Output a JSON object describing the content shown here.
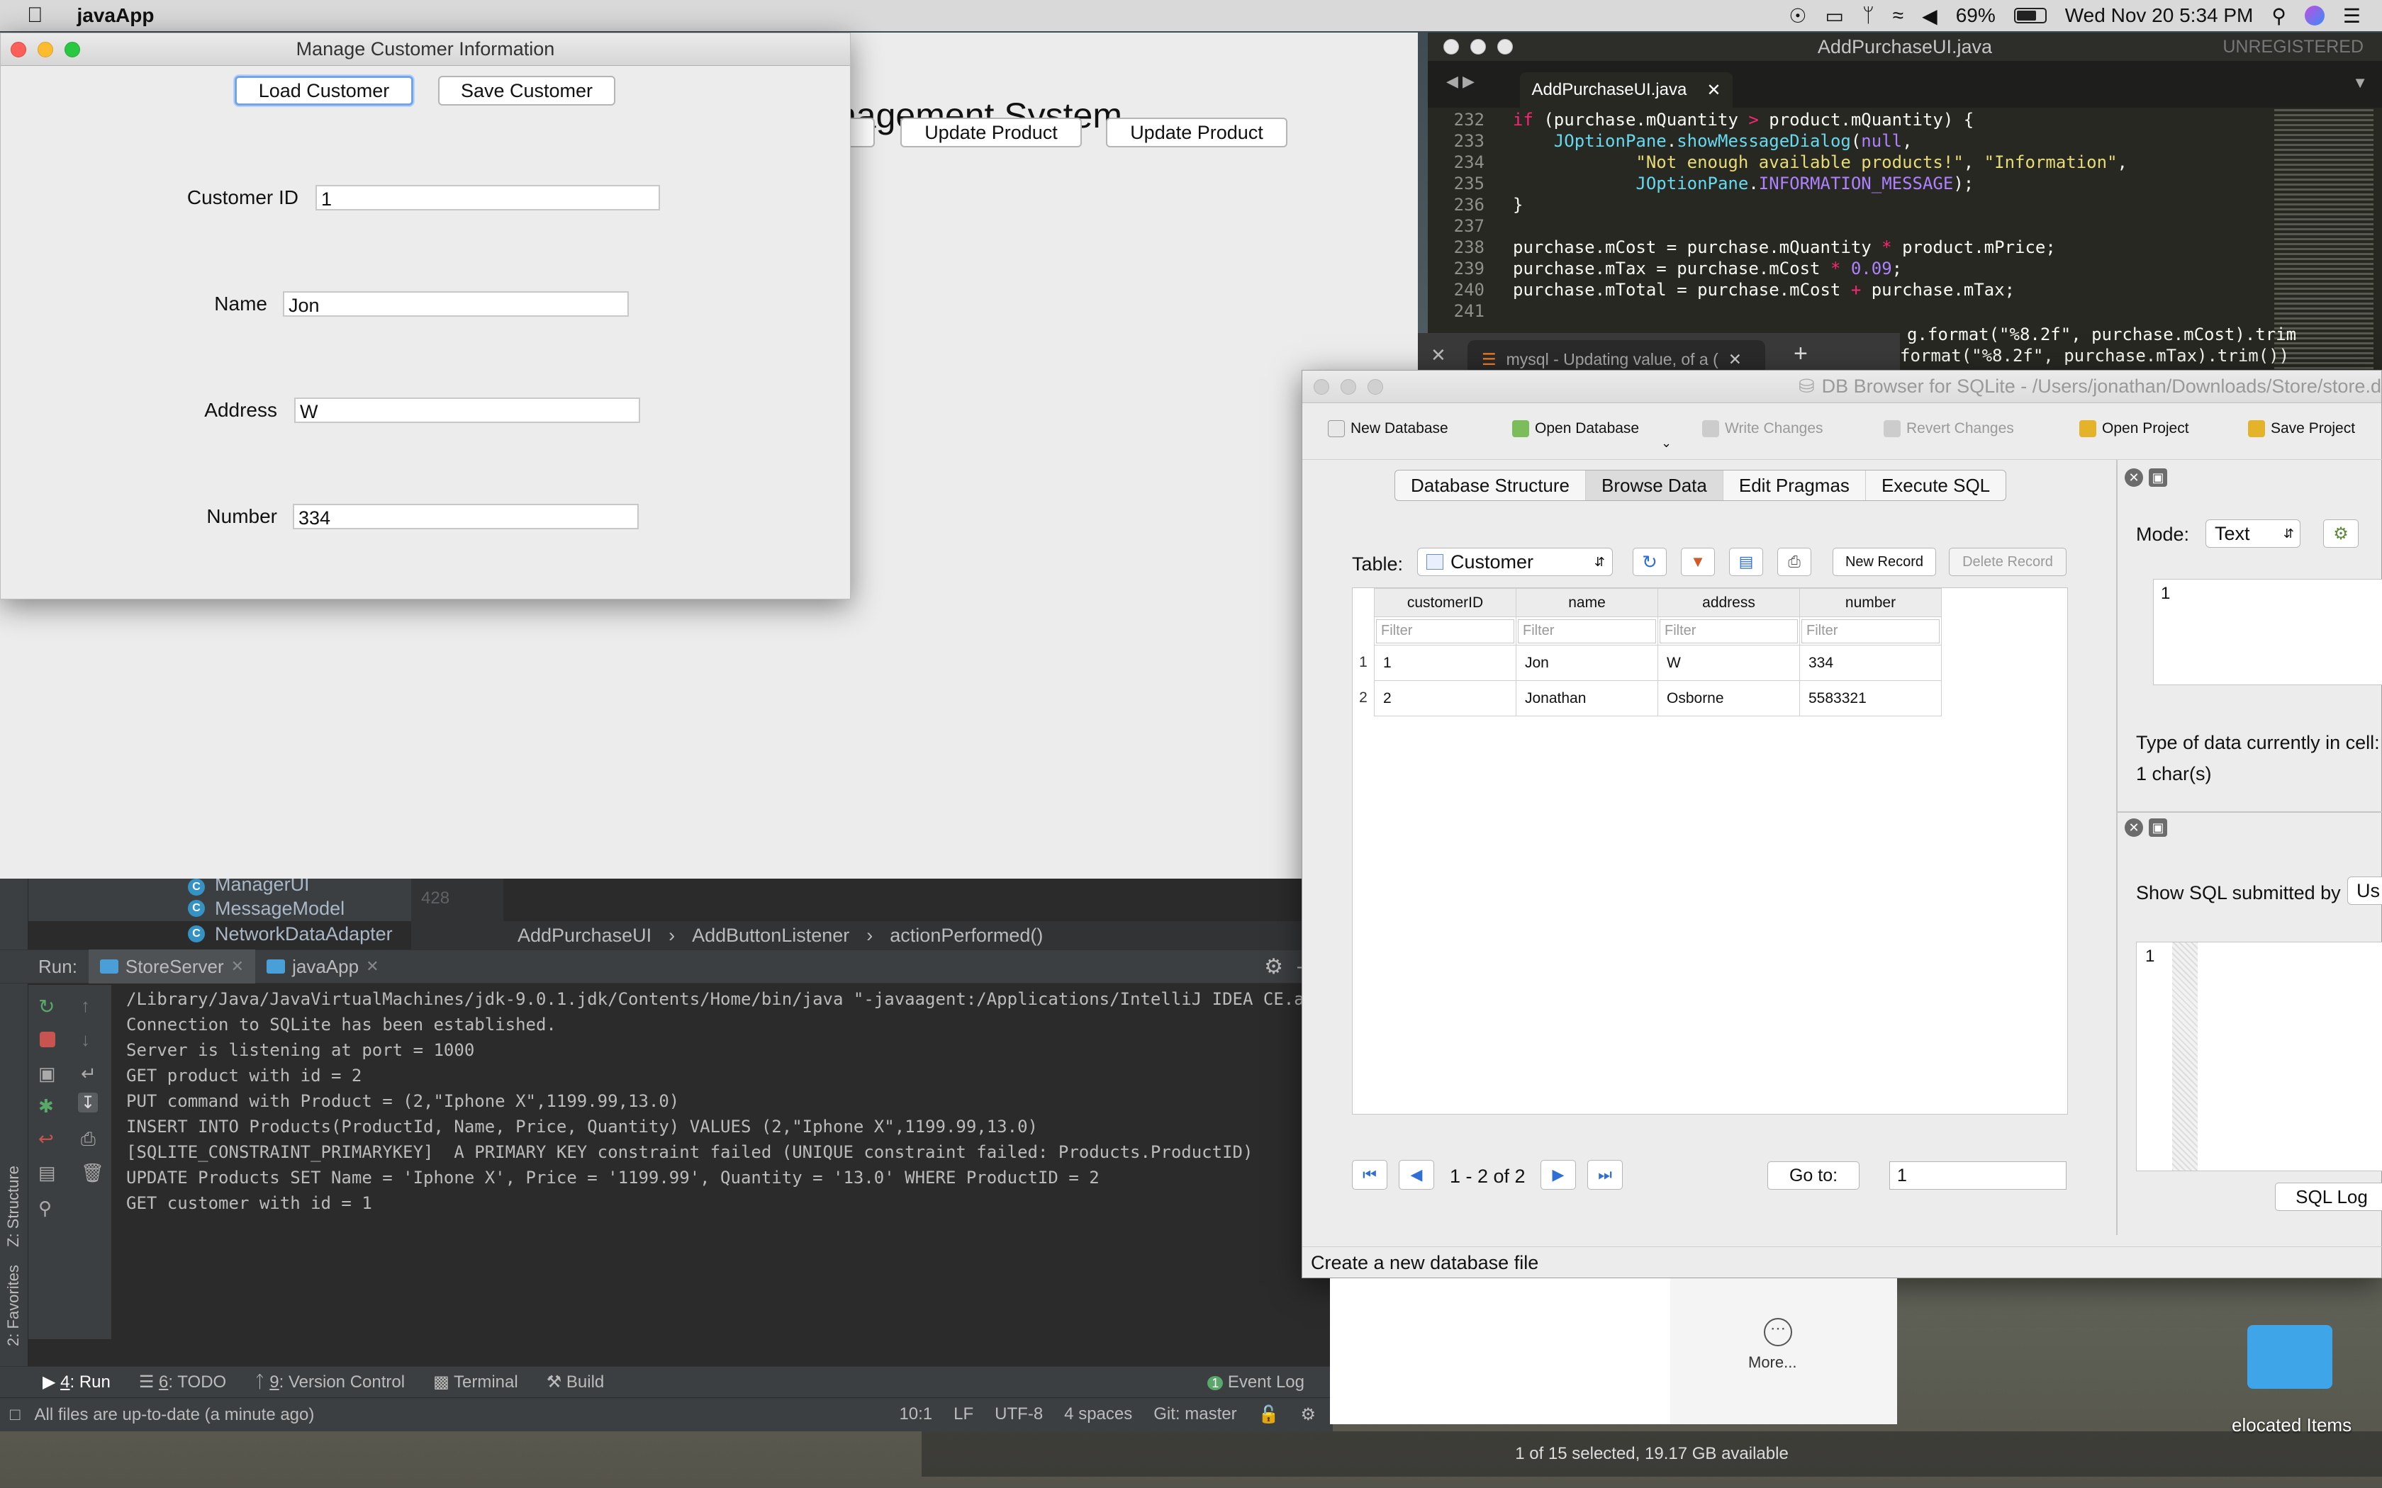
{
  "menubar": {
    "app_name": "javaApp",
    "battery": "69%",
    "datetime": "Wed Nov 20  5:34 PM"
  },
  "java_main": {
    "title_partial": "nagement System",
    "buttons": [
      "Update Product",
      "Update Product"
    ]
  },
  "customer_window": {
    "title": "Manage Customer Information",
    "load_label": "Load Customer",
    "save_label": "Save Customer",
    "fields": [
      {
        "label": "Customer ID",
        "value": "1"
      },
      {
        "label": "Name",
        "value": "Jon"
      },
      {
        "label": "Address",
        "value": "W"
      },
      {
        "label": "Number",
        "value": "334"
      }
    ]
  },
  "sublime": {
    "title": "AddPurchaseUI.java",
    "unregistered": "UNREGISTERED",
    "tab": "AddPurchaseUI.java",
    "line_numbers": [
      "232",
      "233",
      "234",
      "235",
      "236",
      "237",
      "238",
      "239",
      "240",
      "241"
    ],
    "overflow_line_1": "g.format(\"%8.2f\", purchase.mCost).trim",
    "overflow_line_2": "format(\"%8.2f\", purchase.mTax).trim())"
  },
  "browser_tab": {
    "title": "mysql - Updating value, of a (",
    "plus": "+"
  },
  "intellij": {
    "tree_items": [
      "ManagerUI",
      "MessageModel",
      "NetworkDataAdapter"
    ],
    "gutter": "428",
    "breadcrumbs": [
      "AddPurchaseUI",
      "AddButtonListener",
      "actionPerformed()"
    ],
    "run_label": "Run:",
    "run_tabs": [
      "StoreServer",
      "javaApp"
    ],
    "console": [
      "/Library/Java/JavaVirtualMachines/jdk-9.0.1.jdk/Contents/Home/bin/java \"-javaagent:/Applications/IntelliJ IDEA CE.app/C",
      "Connection to SQLite has been established.",
      "Server is listening at port = 1000",
      "GET product with id = 2",
      "PUT command with Product = (2,\"Iphone X\",1199.99,13.0)",
      "INSERT INTO Products(ProductId, Name, Price, Quantity) VALUES (2,\"Iphone X\",1199.99,13.0)",
      "[SQLITE_CONSTRAINT_PRIMARYKEY]  A PRIMARY KEY constraint failed (UNIQUE constraint failed: Products.ProductID)",
      "UPDATE Products SET Name = 'Iphone X', Price = '1199.99', Quantity = '13.0' WHERE ProductID = 2",
      "GET customer with id = 1"
    ],
    "bottom_tabs": [
      {
        "num": "4",
        "label": ": Run"
      },
      {
        "num": "6",
        "label": ": TODO"
      },
      {
        "num": "9",
        "label": ": Version Control"
      },
      {
        "num": "",
        "label": "Terminal"
      },
      {
        "num": "",
        "label": "Build"
      }
    ],
    "event_log": "Event Log",
    "event_count": "1",
    "status_msg": "All files are up-to-date (a minute ago)",
    "status_right": [
      "10:1",
      "LF",
      "UTF-8",
      "4 spaces",
      "Git: master"
    ],
    "side_structure": "Z: Structure",
    "side_favorites": "2: Favorites"
  },
  "dbbrowser": {
    "title": "DB Browser for SQLite - /Users/jonathan/Downloads/Store/store.db",
    "toolbar": [
      "New Database",
      "Open Database",
      "Write Changes",
      "Revert Changes",
      "Open Project",
      "Save Project"
    ],
    "tabs": [
      "Database Structure",
      "Browse Data",
      "Edit Pragmas",
      "Execute SQL"
    ],
    "table_label": "Table:",
    "table_value": "Customer",
    "new_record": "New Record",
    "delete_record": "Delete Record",
    "columns": [
      "customerID",
      "name",
      "address",
      "number"
    ],
    "filter_placeholder": "Filter",
    "rows": [
      {
        "n": "1",
        "cells": [
          "1",
          "Jon",
          "W",
          "334"
        ]
      },
      {
        "n": "2",
        "cells": [
          "2",
          "Jonathan",
          "Osborne",
          "5583321"
        ]
      }
    ],
    "pager": "1 - 2 of 2",
    "goto_label": "Go to:",
    "goto_value": "1",
    "status": "Create a new database file",
    "right": {
      "mode_label": "Mode:",
      "mode_value": "Text",
      "cell_value": "1",
      "type_label": "Type of data currently in cell:",
      "char_count": "1 char(s)",
      "show_sql": "Show SQL submitted by",
      "sql_combo": "Us",
      "sql_line": "1",
      "sql_log": "SQL Log"
    }
  },
  "desktop": {
    "more": "More...",
    "finder_status": "1 of 15 selected, 19.17 GB available",
    "folder_label": "elocated Items"
  }
}
